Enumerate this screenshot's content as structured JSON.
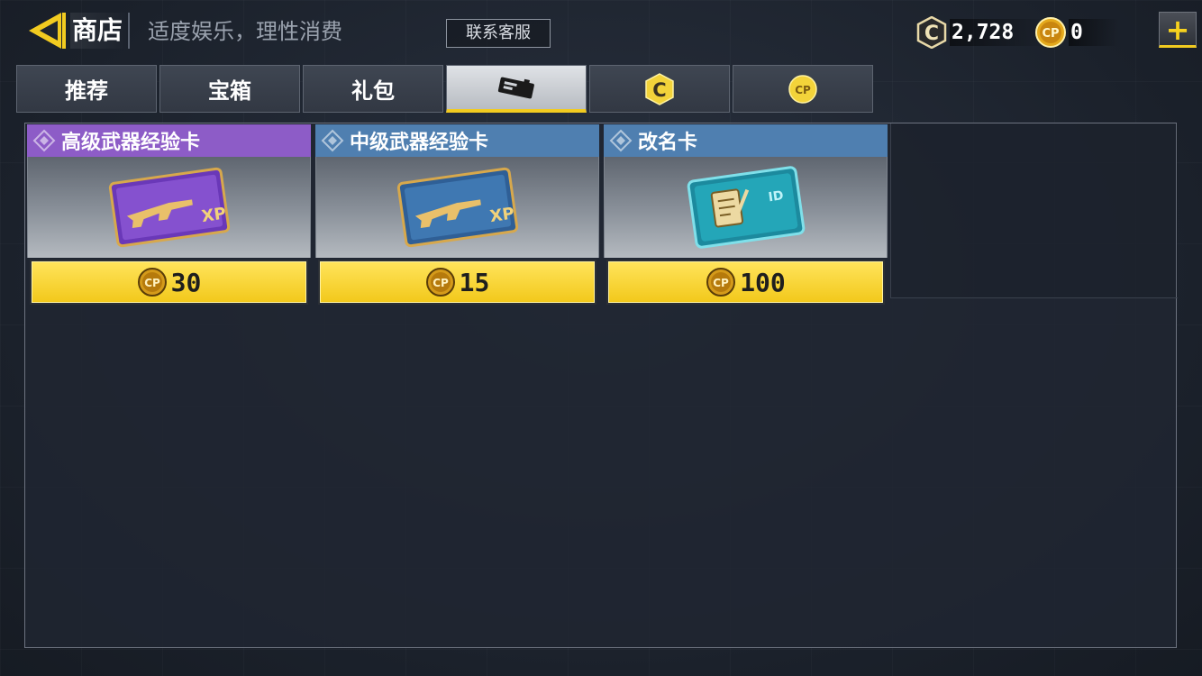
{
  "header": {
    "title": "商店",
    "slogan": "适度娱乐，理性消费",
    "support_label": "联系客服",
    "back_icon": "back-arrow-icon",
    "add_icon": "plus-icon",
    "add_label": "+"
  },
  "wallet": {
    "c_coins": "2,728",
    "cp": "0"
  },
  "tabs": [
    {
      "label": "推荐",
      "icon": null,
      "active": false
    },
    {
      "label": "宝箱",
      "icon": null,
      "active": false
    },
    {
      "label": "礼包",
      "icon": null,
      "active": false
    },
    {
      "label": "",
      "icon": "card-icon",
      "active": true
    },
    {
      "label": "",
      "icon": "c-coin-icon",
      "active": false
    },
    {
      "label": "",
      "icon": "cp-coin-icon",
      "active": false
    }
  ],
  "products": [
    {
      "name": "高级武器经验卡",
      "price": "30",
      "currency": "CP",
      "header_color": "#8d5cc7",
      "image": "weapon-xp-card-purple-icon"
    },
    {
      "name": "中级武器经验卡",
      "price": "15",
      "currency": "CP",
      "header_color": "#4f7fb0",
      "image": "weapon-xp-card-blue-icon"
    },
    {
      "name": "改名卡",
      "price": "100",
      "currency": "CP",
      "header_color": "#4f7fb0",
      "image": "rename-card-icon"
    }
  ],
  "colors": {
    "accent_yellow": "#f2cb20",
    "purple_header": "#8d5cc7",
    "blue_header": "#4f7fb0"
  },
  "icon_text": {
    "c": "C",
    "cp": "CP",
    "xp": "XP",
    "id": "ID"
  }
}
